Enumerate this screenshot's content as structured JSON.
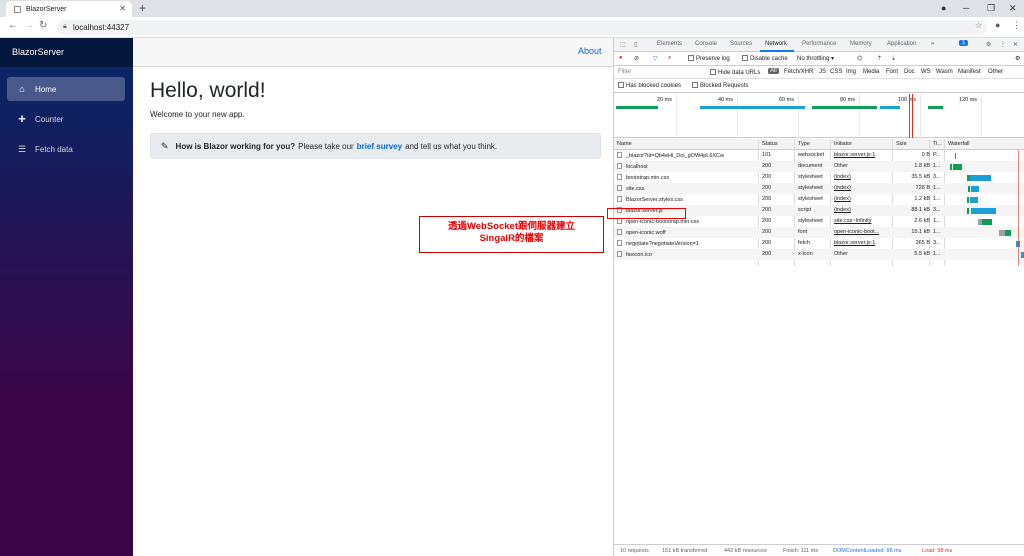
{
  "browser": {
    "tab_title": "BlazorServer",
    "new_tab": "+",
    "url": "localhost:44327"
  },
  "app": {
    "brand": "BlazorServer",
    "nav": [
      {
        "label": "Home",
        "icon": "home-icon",
        "active": true
      },
      {
        "label": "Counter",
        "icon": "plus-icon",
        "active": false
      },
      {
        "label": "Fetch data",
        "icon": "list-icon",
        "active": false
      }
    ],
    "about": "About",
    "heading": "Hello, world!",
    "welcome": "Welcome to your new app.",
    "survey": {
      "question": "How is Blazor working for you?",
      "before_link": "Please take our",
      "link": "brief survey",
      "after_link": "and tell us what you think."
    }
  },
  "annotation": {
    "line1": "透過WebSocket跟伺服器建立",
    "line2": "SingalR的檔案"
  },
  "devtools": {
    "tabs": [
      "Elements",
      "Console",
      "Sources",
      "Network",
      "Performance",
      "Memory",
      "Application",
      "»"
    ],
    "active_tab": "Network",
    "issues_badge": "1",
    "toolbar": {
      "preserve_log": "Preserve log",
      "disable_cache": "Disable cache",
      "throttling": "No throttling"
    },
    "filter": {
      "placeholder": "Filter",
      "hide_data_urls": "Hide data URLs",
      "types": [
        "All",
        "Fetch/XHR",
        "JS",
        "CSS",
        "Img",
        "Media",
        "Font",
        "Doc",
        "WS",
        "Wasm",
        "Manifest",
        "Other"
      ],
      "has_blocked_cookies": "Has blocked cookies",
      "blocked_requests": "Blocked Requests"
    },
    "timeline_ticks": [
      "20 ms",
      "40 ms",
      "60 ms",
      "80 ms",
      "100 ms",
      "120 ms"
    ],
    "columns": [
      "Name",
      "Status",
      "Type",
      "Initiator",
      "Size",
      "Ti...",
      "Waterfall"
    ],
    "rows": [
      {
        "name": "_blazor?id=Qb4eHi_Doi_gOW4pL6XCw",
        "status": "101",
        "type": "websocket",
        "initiator": "blazor.server.js:1",
        "link": true,
        "size": "0 B",
        "time": "P..."
      },
      {
        "name": "localhost",
        "status": "200",
        "type": "document",
        "initiator": "Other",
        "link": false,
        "size": "1.8 kB",
        "time": "1..."
      },
      {
        "name": "bootstrap.min.css",
        "status": "200",
        "type": "stylesheet",
        "initiator": "(index)",
        "link": true,
        "size": "35.5 kB",
        "time": "3..."
      },
      {
        "name": "site.css",
        "status": "200",
        "type": "stylesheet",
        "initiator": "(index)",
        "link": true,
        "size": "728 B",
        "time": "1..."
      },
      {
        "name": "BlazorServer.styles.css",
        "status": "200",
        "type": "stylesheet",
        "initiator": "(index)",
        "link": true,
        "size": "1.2 kB",
        "time": "1..."
      },
      {
        "name": "blazor.server.js",
        "status": "200",
        "type": "script",
        "initiator": "(index)",
        "link": true,
        "size": "88.1 kB",
        "time": "3..."
      },
      {
        "name": "open-iconic-bootstrap.min.css",
        "status": "200",
        "type": "stylesheet",
        "initiator": "site.css~Infinity",
        "link": true,
        "size": "2.6 kB",
        "time": "1..."
      },
      {
        "name": "open-iconic.woff",
        "status": "200",
        "type": "font",
        "initiator": "open-iconic-boot...",
        "link": true,
        "size": "15.1 kB",
        "time": "1..."
      },
      {
        "name": "negotiate?negotiateVersion=1",
        "status": "200",
        "type": "fetch",
        "initiator": "blazor.server.js:1",
        "link": true,
        "size": "365 B",
        "time": "3..."
      },
      {
        "name": "favicon.ico",
        "status": "200",
        "type": "x-icon",
        "initiator": "Other",
        "link": false,
        "size": "5.5 kB",
        "time": "1..."
      }
    ],
    "status_bar": [
      "10 requests",
      "151 kB transferred",
      "442 kB resources",
      "Finish: 111 ms",
      "DOMContentLoaded: 96 ms",
      "Load: 98 ms"
    ],
    "colors": {
      "domcontentloaded": "#1a73e8",
      "load": "#d93025",
      "waterfall_blue": "#1a9fd9",
      "waterfall_green": "#0f9d58"
    }
  }
}
